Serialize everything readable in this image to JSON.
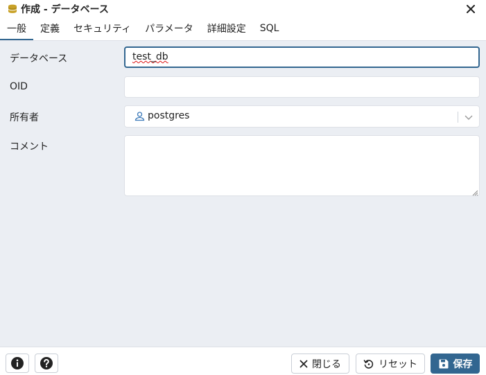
{
  "window": {
    "title": "作成 - データベース",
    "title_icon": "database-icon",
    "close_icon": "close-icon"
  },
  "tabs": [
    {
      "label": "一般",
      "active": true
    },
    {
      "label": "定義",
      "active": false
    },
    {
      "label": "セキュリティ",
      "active": false
    },
    {
      "label": "パラメータ",
      "active": false
    },
    {
      "label": "詳細設定",
      "active": false
    },
    {
      "label": "SQL",
      "active": false
    }
  ],
  "form": {
    "database": {
      "label": "データベース",
      "value": "test_db"
    },
    "oid": {
      "label": "OID",
      "value": ""
    },
    "owner": {
      "label": "所有者",
      "value": "postgres",
      "icon": "user-icon"
    },
    "comment": {
      "label": "コメント",
      "value": ""
    }
  },
  "footer": {
    "info_icon": "info-icon",
    "help_icon": "help-icon",
    "close_label": "閉じる",
    "reset_label": "リセット",
    "save_label": "保存"
  },
  "colors": {
    "accent": "#326690",
    "background": "#ebeef3",
    "border": "#dde0e6"
  }
}
